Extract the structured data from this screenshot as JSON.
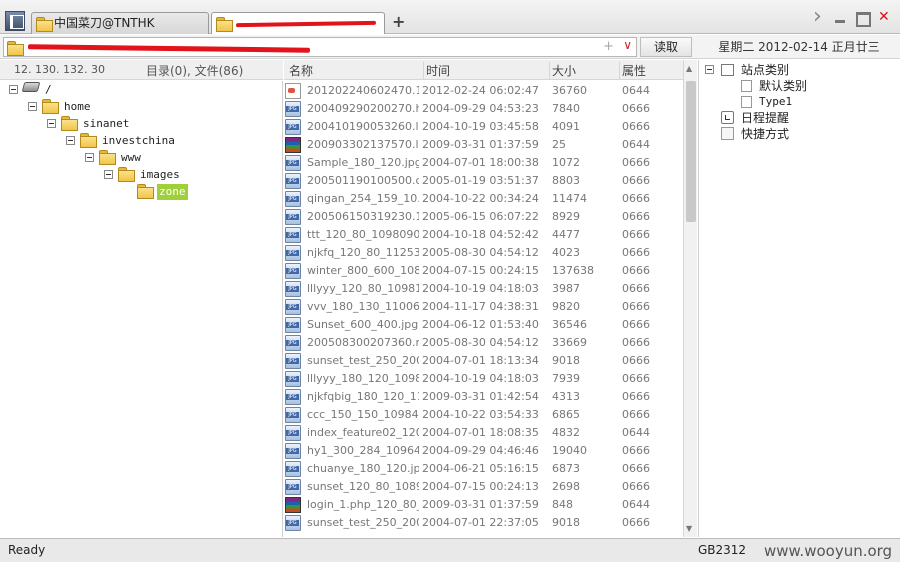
{
  "tabs": [
    {
      "label": "中国菜刀@TNTHK",
      "active": false
    },
    {
      "label": "",
      "active": true
    }
  ],
  "address": {
    "value": "",
    "read_label": "读取",
    "plus": "+",
    "dropdown": "∨"
  },
  "date_label": "星期二 2012-02-14 正月廿三",
  "left_header": {
    "ip": "12. 130. 132. 30",
    "counts": "目录(0), 文件(86)"
  },
  "tree": [
    {
      "label": "/",
      "icon": "drive-icon",
      "level": 0
    },
    {
      "label": "home",
      "icon": "folder-icon",
      "level": 1
    },
    {
      "label": "sinanet",
      "icon": "folder-icon",
      "level": 2
    },
    {
      "label": "investchina",
      "icon": "folder-icon",
      "level": 3
    },
    {
      "label": "www",
      "icon": "folder-icon",
      "level": 4
    },
    {
      "label": "images",
      "icon": "folder-icon",
      "level": 5
    },
    {
      "label": "zone",
      "icon": "folder-open-icon",
      "level": 6,
      "selected": true
    }
  ],
  "columns": {
    "name": "名称",
    "time": "时间",
    "size": "大小",
    "attr": "属性"
  },
  "files": [
    {
      "name": "201202240602470.1....",
      "time": "2012-02-24 06:02:47",
      "size": "36760",
      "attr": "0644",
      "icon": "html"
    },
    {
      "name": "200409290200270.h...",
      "time": "2004-09-29 04:53:23",
      "size": "7840",
      "attr": "0666",
      "icon": "jpg"
    },
    {
      "name": "200410190053260.lll...",
      "time": "2004-10-19 03:45:58",
      "size": "4091",
      "attr": "0666",
      "icon": "jpg"
    },
    {
      "name": "200903302137570.lo...",
      "time": "2009-03-31 01:37:59",
      "size": "25",
      "attr": "0644",
      "icon": "rar"
    },
    {
      "name": "Sample_180_120.jpg",
      "time": "2004-07-01 18:00:38",
      "size": "1072",
      "attr": "0666",
      "icon": "jpg"
    },
    {
      "name": "200501190100500.d...",
      "time": "2005-01-19 03:51:37",
      "size": "8803",
      "attr": "0666",
      "icon": "jpg"
    },
    {
      "name": "qingan_254_159_10...",
      "time": "2004-10-22 00:34:24",
      "size": "11474",
      "attr": "0666",
      "icon": "jpg"
    },
    {
      "name": "200506150319230.1...",
      "time": "2005-06-15 06:07:22",
      "size": "8929",
      "attr": "0666",
      "icon": "jpg"
    },
    {
      "name": "ttt_120_80_1098090...",
      "time": "2004-10-18 04:52:42",
      "size": "4477",
      "attr": "0666",
      "icon": "jpg"
    },
    {
      "name": "njkfq_120_80_11253...",
      "time": "2005-08-30 04:54:12",
      "size": "4023",
      "attr": "0666",
      "icon": "jpg"
    },
    {
      "name": "winter_800_600_108...",
      "time": "2004-07-15 00:24:15",
      "size": "137638",
      "attr": "0666",
      "icon": "jpg"
    },
    {
      "name": "lllyyy_120_80_10981...",
      "time": "2004-10-19 04:18:03",
      "size": "3987",
      "attr": "0666",
      "icon": "jpg"
    },
    {
      "name": "vvv_180_130_11006...",
      "time": "2004-11-17 04:38:31",
      "size": "9820",
      "attr": "0666",
      "icon": "jpg"
    },
    {
      "name": "Sunset_600_400.jpg",
      "time": "2004-06-12 01:53:40",
      "size": "36546",
      "attr": "0666",
      "icon": "jpg"
    },
    {
      "name": "200508300207360.nj...",
      "time": "2005-08-30 04:54:12",
      "size": "33669",
      "attr": "0666",
      "icon": "jpg"
    },
    {
      "name": "sunset_test_250_200...",
      "time": "2004-07-01 18:13:34",
      "size": "9018",
      "attr": "0666",
      "icon": "jpg"
    },
    {
      "name": "lllyyy_180_120_1098...",
      "time": "2004-10-19 04:18:03",
      "size": "7939",
      "attr": "0666",
      "icon": "jpg"
    },
    {
      "name": "njkfqbig_180_120_11...",
      "time": "2009-03-31 01:42:54",
      "size": "4313",
      "attr": "0666",
      "icon": "jpg"
    },
    {
      "name": "ccc_150_150_10984...",
      "time": "2004-10-22 03:54:33",
      "size": "6865",
      "attr": "0666",
      "icon": "jpg"
    },
    {
      "name": "index_feature02_120...",
      "time": "2004-07-01 18:08:35",
      "size": "4832",
      "attr": "0644",
      "icon": "jpg"
    },
    {
      "name": "hy1_300_284_10964...",
      "time": "2004-09-29 04:46:46",
      "size": "19040",
      "attr": "0666",
      "icon": "jpg"
    },
    {
      "name": "chuanye_180_120.jpg",
      "time": "2004-06-21 05:16:15",
      "size": "6873",
      "attr": "0666",
      "icon": "jpg"
    },
    {
      "name": "sunset_120_80_1089...",
      "time": "2004-07-15 00:24:13",
      "size": "2698",
      "attr": "0666",
      "icon": "jpg"
    },
    {
      "name": "login_1.php_120_80_...",
      "time": "2009-03-31 01:37:59",
      "size": "848",
      "attr": "0644",
      "icon": "rar"
    },
    {
      "name": "sunset_test_250_200...",
      "time": "2004-07-01 22:37:05",
      "size": "9018",
      "attr": "0666",
      "icon": "jpg"
    }
  ],
  "right_tree": [
    {
      "label": "站点类别",
      "kind": "root",
      "icon": "box"
    },
    {
      "label": "默认类别",
      "kind": "child",
      "icon": "doc"
    },
    {
      "label": "Type1",
      "kind": "child",
      "icon": "doc"
    },
    {
      "label": "日程提醒",
      "kind": "root",
      "icon": "clock"
    },
    {
      "label": "快捷方式",
      "kind": "root",
      "icon": "link"
    }
  ],
  "status": {
    "text": "Ready",
    "encoding": "GB2312",
    "watermark": "www.wooyun.org"
  }
}
